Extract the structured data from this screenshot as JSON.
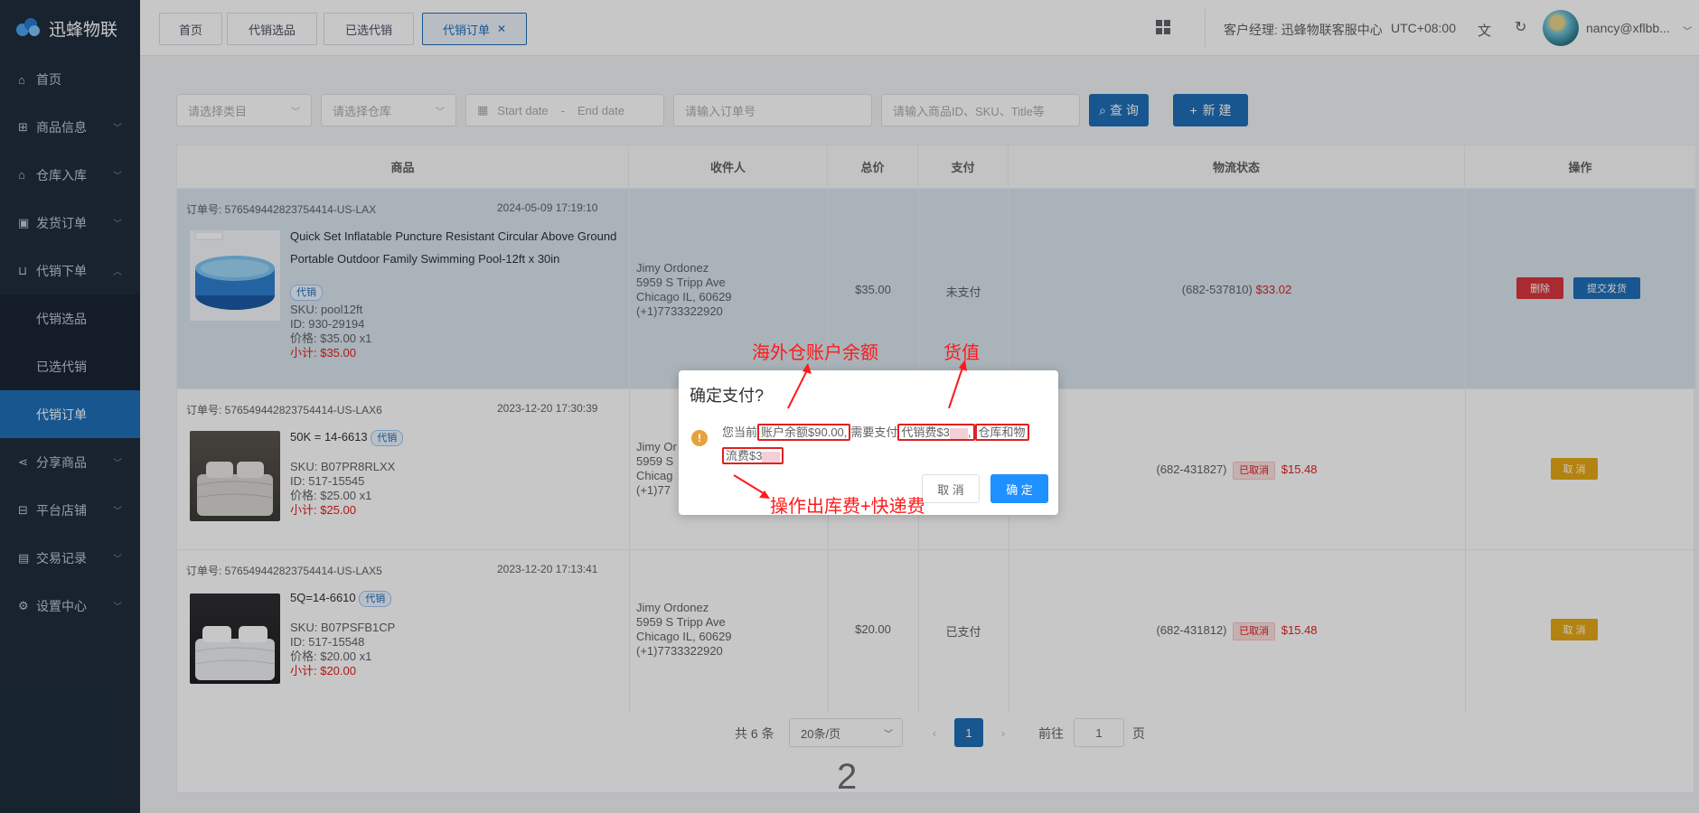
{
  "app": {
    "logo_text": "迅蜂物联"
  },
  "sidebar": {
    "items": [
      {
        "label": "首页",
        "icon": "home-icon"
      },
      {
        "label": "商品信息",
        "icon": "gift-icon"
      },
      {
        "label": "仓库入库",
        "icon": "warehouse-icon"
      },
      {
        "label": "发货订单",
        "icon": "shipping-icon"
      },
      {
        "label": "代销下单",
        "icon": "cart-icon"
      },
      {
        "label": "分享商品",
        "icon": "share-icon"
      },
      {
        "label": "平台店铺",
        "icon": "store-icon"
      },
      {
        "label": "交易记录",
        "icon": "record-icon"
      },
      {
        "label": "设置中心",
        "icon": "settings-icon"
      }
    ],
    "subitems": [
      {
        "label": "代销选品"
      },
      {
        "label": "已选代销"
      },
      {
        "label": "代销订单"
      }
    ]
  },
  "tabs": [
    "首页",
    "代销选品",
    "已选代销",
    "代销订单"
  ],
  "topbar": {
    "manager": "客户经理: 迅蜂物联客服中心",
    "timezone": "UTC+08:00",
    "username": "nancy@xflbb..."
  },
  "filters": {
    "category_placeholder": "请选择类目",
    "warehouse_placeholder": "请选择仓库",
    "start_date": "Start date",
    "date_sep": "-",
    "end_date": "End date",
    "order_placeholder": "请输入订单号",
    "product_placeholder": "请输入商品ID、SKU、Title等",
    "search_label": "查 询",
    "new_label": "新 建"
  },
  "table": {
    "headers": [
      "商品",
      "收件人",
      "总价",
      "支付",
      "物流状态",
      "操作"
    ],
    "rows": [
      {
        "order_no": "订单号: 576549442823754414-US-LAX",
        "date": "2024-05-09 17:19:10",
        "title": "Quick Set Inflatable Puncture Resistant Circular Above Ground Portable Outdoor Family Swimming Pool-12ft x 30in",
        "tag": "代销",
        "sku": "SKU: pool12ft",
        "id": "ID: 930-29194",
        "price": "价格: $35.00 x1",
        "subtotal": "小计: $35.00",
        "recv": [
          "Jimy Ordonez",
          "5959 S Tripp Ave",
          "Chicago IL, 60629",
          "(+1)7733322920"
        ],
        "total": "$35.00",
        "pay": "未支付",
        "logistics_code": "(682-537810)",
        "logistics_amount": "$33.02",
        "btn1": "删除",
        "btn2": "提交发货"
      },
      {
        "order_no": "订单号: 576549442823754414-US-LAX6",
        "date": "2023-12-20 17:30:39",
        "title": "50K = 14-6613",
        "tag": "代销",
        "sku": "SKU: B07PR8RLXX",
        "id": "ID: 517-15545",
        "price": "价格: $25.00 x1",
        "subtotal": "小计: $25.00",
        "recv": [
          "Jimy Or",
          "5959 S",
          "Chicag",
          "(+1)77"
        ],
        "logistics_code": "(682-431827)",
        "logistics_status": "已取消",
        "logistics_amount": "$15.48",
        "btn": "取 消"
      },
      {
        "order_no": "订单号: 576549442823754414-US-LAX5",
        "date": "2023-12-20 17:13:41",
        "title": "5Q=14-6610",
        "tag": "代销",
        "sku": "SKU: B07PSFB1CP",
        "id": "ID: 517-15548",
        "price": "价格: $20.00 x1",
        "subtotal": "小计: $20.00",
        "recv": [
          "Jimy Ordonez",
          "5959 S Tripp Ave",
          "Chicago IL, 60629",
          "(+1)7733322920"
        ],
        "total": "$20.00",
        "pay": "已支付",
        "logistics_code": "(682-431812)",
        "logistics_status": "已取消",
        "logistics_amount": "$15.48",
        "btn": "取 消"
      }
    ]
  },
  "pagination": {
    "total": "共 6 条",
    "page_size": "20条/页",
    "current": "1",
    "goto_label": "前往",
    "goto_value": "1",
    "page_unit": "页"
  },
  "dialog": {
    "title": "确定支付?",
    "msg_prefix": "您当前",
    "balance": "账户余额$90.00,",
    "need_pay": "需要支付",
    "goods_fee": "代销费$3",
    "warehouse_fee_a": "仓库和物",
    "warehouse_fee_b": "流费$3",
    "cancel": "取 消",
    "ok": "确 定"
  },
  "annotations": {
    "balance": "海外仓账户余额",
    "goods_value": "货值",
    "fees": "操作出库费+快递费",
    "page_number": "2"
  },
  "colors": {
    "primary": "#1f6fb8",
    "danger": "#e02020",
    "warning": "#e6a23c",
    "sidebar": "#1f2d3d",
    "annotation": "#ff1a1a"
  }
}
